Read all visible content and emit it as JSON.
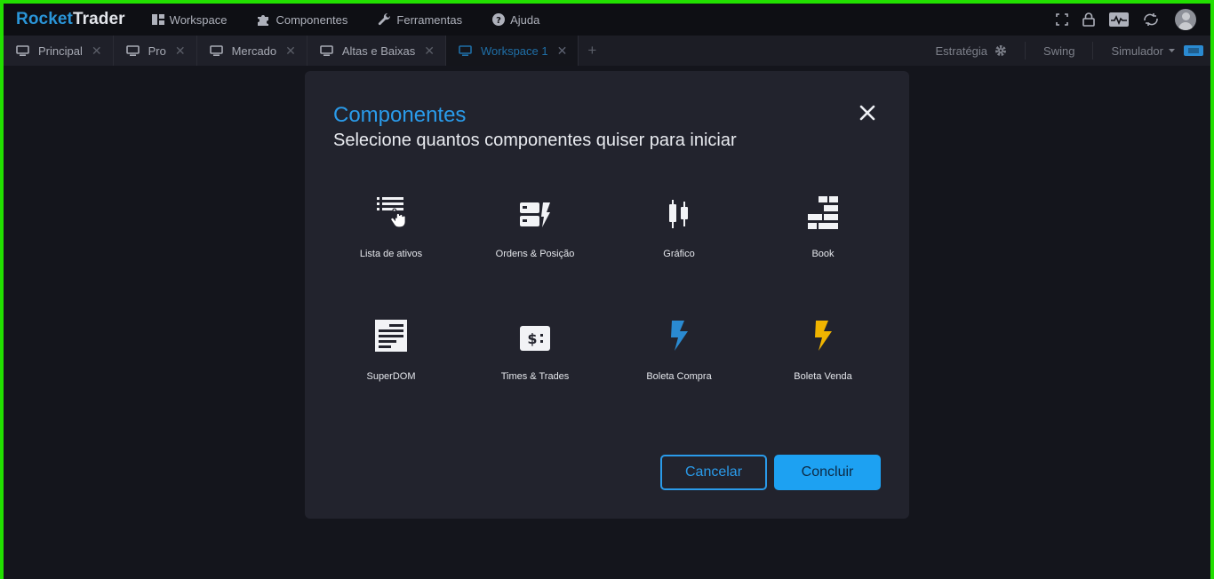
{
  "app": {
    "logo_part1": "Rocket",
    "logo_part2": "Trader"
  },
  "menu": [
    {
      "label": "Workspace",
      "icon": "dashboard-icon"
    },
    {
      "label": "Componentes",
      "icon": "puzzle-icon"
    },
    {
      "label": "Ferramentas",
      "icon": "wrench-icon"
    },
    {
      "label": "Ajuda",
      "icon": "help-icon"
    }
  ],
  "tabs": [
    {
      "label": "Principal",
      "active": false
    },
    {
      "label": "Pro",
      "active": false
    },
    {
      "label": "Mercado",
      "active": false
    },
    {
      "label": "Altas e Baixas",
      "active": false
    },
    {
      "label": "Workspace 1",
      "active": true
    }
  ],
  "tab_right": {
    "strategy": "Estratégia",
    "swing": "Swing",
    "simulator": "Simulador"
  },
  "modal": {
    "title": "Componentes",
    "subtitle": "Selecione quantos componentes quiser para iniciar",
    "components": [
      {
        "label": "Lista de ativos",
        "icon": "list-icon"
      },
      {
        "label": "Ordens & Posição",
        "icon": "orders-icon"
      },
      {
        "label": "Gráfico",
        "icon": "candlestick-icon"
      },
      {
        "label": "Book",
        "icon": "book-icon"
      },
      {
        "label": "SuperDOM",
        "icon": "superdom-icon"
      },
      {
        "label": "Times & Trades",
        "icon": "times-trades-icon"
      },
      {
        "label": "Boleta Compra",
        "icon": "bolt-blue-icon"
      },
      {
        "label": "Boleta Venda",
        "icon": "bolt-yellow-icon"
      }
    ],
    "cancel_label": "Cancelar",
    "ok_label": "Concluir"
  },
  "colors": {
    "accent": "#2a9bea",
    "buy": "#2a8ad1",
    "sell": "#f0b400",
    "frame": "#22e000"
  }
}
